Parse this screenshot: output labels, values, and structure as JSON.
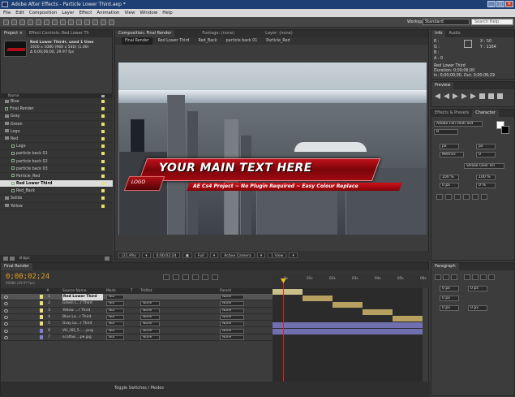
{
  "window": {
    "title": "Adobe After Effects - Particle Lower Third.aep *",
    "btns": [
      "_",
      "□",
      "×"
    ]
  },
  "menu": [
    "File",
    "Edit",
    "Composition",
    "Layer",
    "Effect",
    "Animation",
    "View",
    "Window",
    "Help"
  ],
  "toolbar": {
    "workspace_label": "Workspace:",
    "workspace_value": "Standard",
    "search_placeholder": "Search Help"
  },
  "project": {
    "tabs": [
      "Project ×",
      "Effect Controls: Red Lower Th"
    ],
    "item_name": "Red Lower Third▾, used 1 time",
    "item_res": "1920 x 1080  (960 x 540) (1.00)",
    "item_dur": "Δ 0;00;06;00, 29.97 fps",
    "col_name": "Name",
    "items": [
      {
        "label": "Blue",
        "type": "folder",
        "color": "#e8e070",
        "indent": 0
      },
      {
        "label": "Final Render",
        "type": "comp",
        "color": "#e8e070",
        "indent": 0
      },
      {
        "label": "Gray",
        "type": "folder",
        "color": "#e8e070",
        "indent": 0
      },
      {
        "label": "Green",
        "type": "folder",
        "color": "#e8e070",
        "indent": 0
      },
      {
        "label": "Logo",
        "type": "folder",
        "color": "#e8e070",
        "indent": 0
      },
      {
        "label": "Red",
        "type": "folder",
        "color": "#e8e070",
        "indent": 0
      },
      {
        "label": "Logo",
        "type": "comp",
        "color": "#e8e070",
        "indent": 1
      },
      {
        "label": "particle back 01",
        "type": "comp",
        "color": "#e8e070",
        "indent": 1
      },
      {
        "label": "particle back 02",
        "type": "comp",
        "color": "#e8e070",
        "indent": 1
      },
      {
        "label": "particle back 03",
        "type": "comp",
        "color": "#e8e070",
        "indent": 1
      },
      {
        "label": "Particle_Red",
        "type": "comp",
        "color": "#e8e070",
        "indent": 1
      },
      {
        "label": "Red Lower Third",
        "type": "comp",
        "color": "#e8e070",
        "indent": 1,
        "selected": true
      },
      {
        "label": "Red_Back",
        "type": "comp",
        "color": "#e8e070",
        "indent": 1
      },
      {
        "label": "Solids",
        "type": "folder",
        "color": "#e8e070",
        "indent": 0
      },
      {
        "label": "Yellow",
        "type": "folder",
        "color": "#e8e070",
        "indent": 0
      }
    ],
    "bpc": "8 bpc"
  },
  "viewer": {
    "tabs": [
      "Composition: Final Render",
      "Footage: (none)",
      "Layer: (none)"
    ],
    "nav": [
      "Final Render",
      "Red Lower Third",
      "Red_Back",
      "particle back 01",
      "Particle_Red"
    ],
    "lower_third": {
      "main": "YOUR MAIN TEXT HERE",
      "sub": "AE Cs4 Project ~ No Plugin Required ~ Easy Colour Replace",
      "logo": "LOGO"
    },
    "controls": [
      "(21.9%)",
      "▾",
      "0;00;02;24",
      "▣",
      "Full",
      "▾",
      "Active Camera",
      "▾",
      "1 View",
      "▾"
    ]
  },
  "info": {
    "tabs": [
      "Info",
      "Audio"
    ],
    "r": "R :",
    "g": "G :",
    "b": "B :",
    "a": "A : 0",
    "x": "X : 50",
    "y": "Y : 1164",
    "comp": "Red Lower Third",
    "dur": "Duration: 0;00;06;00",
    "inout": "In: 0;00;00;00, Out: 0;00;06;29"
  },
  "preview": {
    "tab": "Preview"
  },
  "character": {
    "tabs": [
      "Effects & Presets",
      "Character"
    ],
    "font": "Adobe Fan Heiti Std",
    "style": "B",
    "size": "px",
    "lead": "px",
    "kern": "Metrics",
    "track": "0",
    "stroke": "Stroke Over Fill",
    "v": "100 %",
    "h": "100 %",
    "base": "0 px",
    "tsume": "0 %"
  },
  "timeline": {
    "tab": "Final Render",
    "timecode": "0;00;02;24",
    "fps": "00084 (29.97 fps)",
    "cols": [
      "#",
      "Source Name",
      "Mode",
      "T",
      "TrkMat",
      "Parent"
    ],
    "ticks": [
      "0s",
      "01s",
      "02s",
      "03s",
      "04s",
      "05s",
      "06s"
    ],
    "layers": [
      {
        "n": "1",
        "name": "Red Lower Third",
        "mode": "Nor",
        "trk": "",
        "parent": "None",
        "color": "#e8e070",
        "bar_start": 0.0,
        "bar_end": 0.2,
        "bar_color": "#c8c088",
        "sel": true
      },
      {
        "n": "2",
        "name": "Green L...r Third",
        "mode": "Nor",
        "trk": "None",
        "parent": "None",
        "color": "#e8e070",
        "bar_start": 0.2,
        "bar_end": 0.4,
        "bar_color": "#b8a060"
      },
      {
        "n": "3",
        "name": "Yellow ...r Third",
        "mode": "Nor",
        "trk": "None",
        "parent": "None",
        "color": "#e8e070",
        "bar_start": 0.4,
        "bar_end": 0.6,
        "bar_color": "#b8a060"
      },
      {
        "n": "4",
        "name": "Blue Lo...r Third",
        "mode": "Nor",
        "trk": "None",
        "parent": "None",
        "color": "#e8e070",
        "bar_start": 0.6,
        "bar_end": 0.8,
        "bar_color": "#b8a060"
      },
      {
        "n": "5",
        "name": "Gray Lo...r Third",
        "mode": "Nor",
        "trk": "None",
        "parent": "None",
        "color": "#e8e070",
        "bar_start": 0.8,
        "bar_end": 1.0,
        "bar_color": "#b8a060"
      },
      {
        "n": "6",
        "name": "VH_HD_5......png",
        "mode": "Nor",
        "trk": "None",
        "parent": "None",
        "color": "#8080d0",
        "bar_start": 0.0,
        "bar_end": 1.0,
        "bar_color": "#7070b0"
      },
      {
        "n": "7",
        "name": "scottwi....pe.jpg",
        "mode": "Nor",
        "trk": "None",
        "parent": "None",
        "color": "#8080d0",
        "bar_start": 0.0,
        "bar_end": 1.0,
        "bar_color": "#7070b0"
      }
    ],
    "playhead": 0.07,
    "bottom": "Toggle Switches / Modes"
  },
  "paragraph": {
    "tab": "Paragraph",
    "vals": [
      "0 px",
      "0 px",
      "0 px",
      "0 px",
      "0 px"
    ]
  }
}
